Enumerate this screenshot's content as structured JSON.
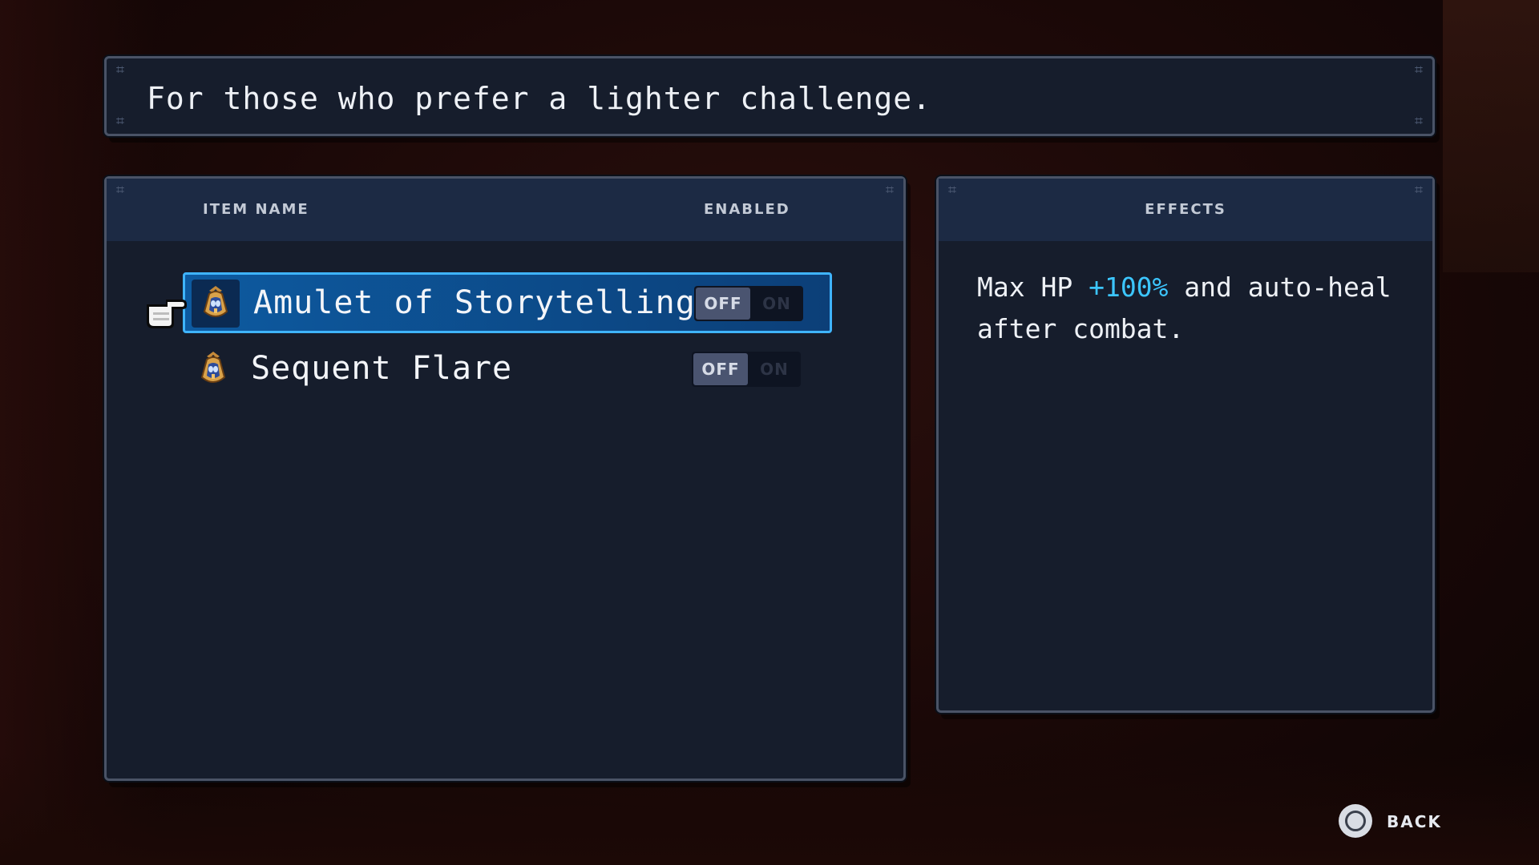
{
  "description": {
    "text": "For those who prefer a lighter challenge."
  },
  "items_panel": {
    "header": {
      "item_name": "ITEM NAME",
      "enabled": "ENABLED"
    },
    "rows": [
      {
        "label": "Amulet of Storytelling",
        "icon": "amulet-icon",
        "selected": true,
        "toggle": {
          "off_label": "OFF",
          "on_label": "ON",
          "state": "OFF"
        }
      },
      {
        "label": "Sequent Flare",
        "icon": "amulet-icon",
        "selected": false,
        "toggle": {
          "off_label": "OFF",
          "on_label": "ON",
          "state": "OFF"
        }
      }
    ]
  },
  "effects_panel": {
    "header": "EFFECTS",
    "text_before": "Max HP ",
    "highlight": "+100%",
    "text_after": " and auto-heal after combat."
  },
  "back": {
    "label": "BACK",
    "icon": "circle-button-icon"
  },
  "colors": {
    "selection_border": "#3fb4ff",
    "selection_fill": "#0d5aa0",
    "highlight_text": "#3cc6ff",
    "panel_bg": "#161d2c",
    "header_bg": "#1c2a44"
  }
}
